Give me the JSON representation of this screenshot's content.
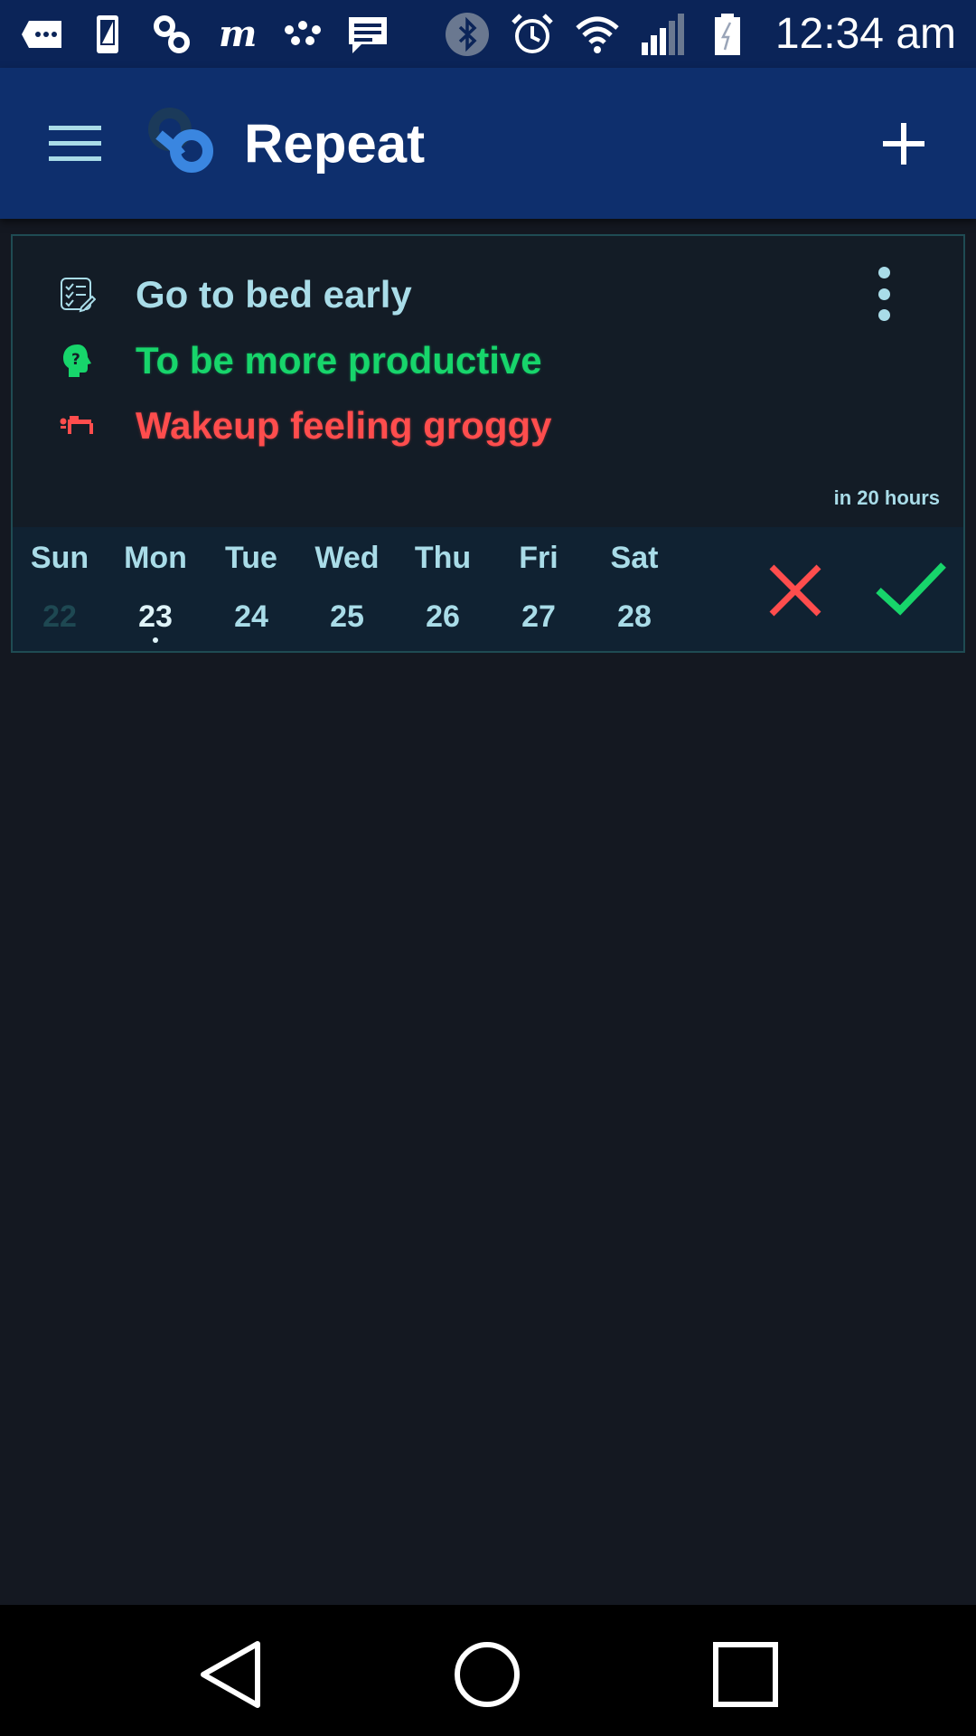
{
  "status_bar": {
    "time": "12:34 am",
    "icons_left": [
      "messages-icon",
      "phone-icon",
      "link-icon",
      "m-app-icon",
      "dots-app-icon",
      "chat-icon"
    ],
    "icons_right": [
      "bluetooth-icon",
      "alarm-icon",
      "wifi-icon",
      "signal-icon",
      "battery-icon"
    ]
  },
  "app_bar": {
    "title": "Repeat",
    "menu_icon": "hamburger-menu-icon",
    "add_icon": "plus-icon",
    "background": "#0e2f6d"
  },
  "habit": {
    "title": "Go to bed early",
    "why": "To be more productive",
    "consequence": "Wakeup feeling groggy",
    "due": "in 20 hours",
    "colors": {
      "title": "#a9dce8",
      "why": "#17d56b",
      "consequence": "#ff4d4d"
    },
    "week": [
      {
        "name": "Sun",
        "num": "22",
        "state": "past"
      },
      {
        "name": "Mon",
        "num": "23",
        "state": "today"
      },
      {
        "name": "Tue",
        "num": "24",
        "state": "future"
      },
      {
        "name": "Wed",
        "num": "25",
        "state": "future"
      },
      {
        "name": "Thu",
        "num": "26",
        "state": "future"
      },
      {
        "name": "Fri",
        "num": "27",
        "state": "future"
      },
      {
        "name": "Sat",
        "num": "28",
        "state": "future"
      }
    ],
    "fail_icon": "cross-icon",
    "done_icon": "check-icon"
  },
  "nav_bar": {
    "back_icon": "back-triangle-icon",
    "home_icon": "home-circle-icon",
    "recents_icon": "recents-square-icon"
  }
}
